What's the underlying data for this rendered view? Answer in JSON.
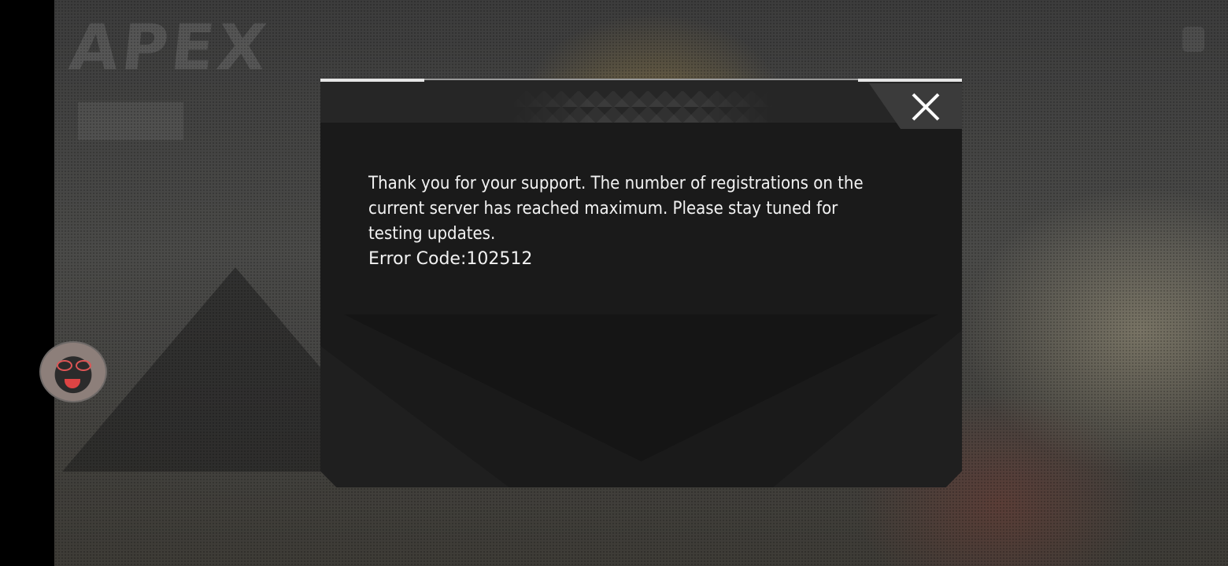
{
  "background": {
    "logo_text": "APEX"
  },
  "dialog": {
    "message": "Thank you for your support. The number of registrations on the current server has reached maximum. Please stay tuned for testing updates.",
    "error_code": "Error Code:102512",
    "close_icon": "close-x-icon"
  },
  "colors": {
    "dialog_bg": "#1a1a1a",
    "header_bg": "#262626",
    "close_bg": "#3b3b3b",
    "text": "#f2f2f2"
  }
}
